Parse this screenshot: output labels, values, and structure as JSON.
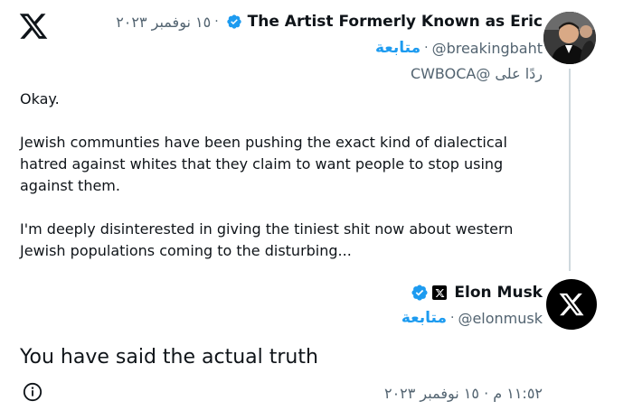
{
  "original_tweet": {
    "display_name": "The Artist Formerly Known as Eric",
    "date": "١٥ نوفمبر ٢٠٢٣",
    "handle": "@breakingbaht",
    "follow_label": "متابعة",
    "replying_to": "ردًا على @CWBOCA",
    "paragraphs": [
      "Okay.",
      "Jewish communties have been pushing the exact kind of dialectical hatred against whites that they claim to want people to stop using against them.",
      "I'm deeply disinterested in giving the tiniest shit now about western Jewish populations coming to the disturbing..."
    ]
  },
  "reply_tweet": {
    "display_name": "Elon Musk",
    "handle": "@elonmusk",
    "follow_label": "متابعة",
    "text": "You have said the actual truth",
    "timestamp": "١١:٥٢ م · ١٥ نوفمبر ٢٠٢٣"
  },
  "colors": {
    "accent": "#1d9bf0",
    "text": "#0f1419",
    "muted": "#536471"
  }
}
